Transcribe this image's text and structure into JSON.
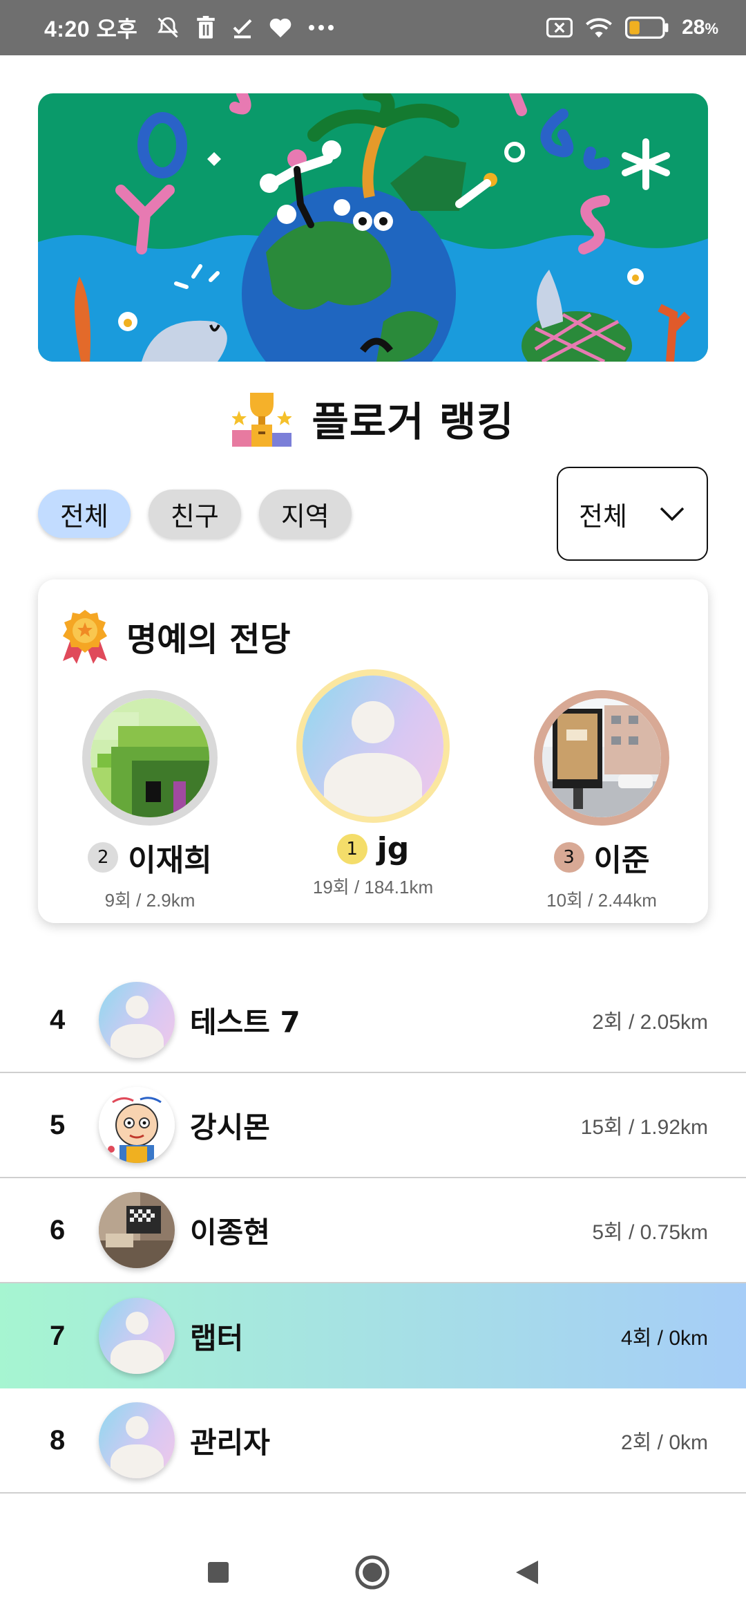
{
  "status_bar": {
    "time": "4:20 오후",
    "battery": "28",
    "battery_unit": "%",
    "icons": [
      "notifications-off-icon",
      "trash-icon",
      "check-icon",
      "heart-icon",
      "more-icon",
      "sim-off-icon",
      "wifi-icon",
      "battery-icon"
    ]
  },
  "page": {
    "title": "플로거 랭킹",
    "title_icon": "trophy-podium-icon"
  },
  "filters": {
    "tabs": [
      {
        "label": "전체",
        "active": true
      },
      {
        "label": "친구",
        "active": false
      },
      {
        "label": "지역",
        "active": false
      }
    ],
    "dropdown_value": "전체"
  },
  "hall_of_fame": {
    "title": "명예의 전당",
    "icon": "medal-icon",
    "podium": [
      {
        "rank": "2",
        "name": "이재희",
        "stats": "9회 / 2.9km",
        "ring_color": "#d9d9d9"
      },
      {
        "rank": "1",
        "name": "jg",
        "stats": "19회 / 184.1km",
        "ring_color": "#fbe7a0"
      },
      {
        "rank": "3",
        "name": "이준",
        "stats": "10회 / 2.44km",
        "ring_color": "#d8a995"
      }
    ]
  },
  "ranking": [
    {
      "rank": "4",
      "name": "테스트 7",
      "stats": "2회 / 2.05km",
      "avatar": "default"
    },
    {
      "rank": "5",
      "name": "강시몬",
      "stats": "15회 / 1.92km",
      "avatar": "cartoon"
    },
    {
      "rank": "6",
      "name": "이종현",
      "stats": "5회 / 0.75km",
      "avatar": "room-photo"
    },
    {
      "rank": "7",
      "name": "랩터",
      "stats": "4회 / 0km",
      "avatar": "default",
      "highlighted": true
    },
    {
      "rank": "8",
      "name": "관리자",
      "stats": "2회 / 0km",
      "avatar": "default"
    }
  ],
  "colors": {
    "active_chip": "#c2dcff",
    "inactive_chip": "#dcdcdc",
    "highlight_start": "#a6f5d1",
    "highlight_end": "#a6cdf7",
    "rank1_badge": "#f4dd6a",
    "rank2_badge": "#dcdcdc",
    "rank3_badge": "#d8a995"
  },
  "nav": [
    "recents-button",
    "home-button",
    "back-button"
  ]
}
